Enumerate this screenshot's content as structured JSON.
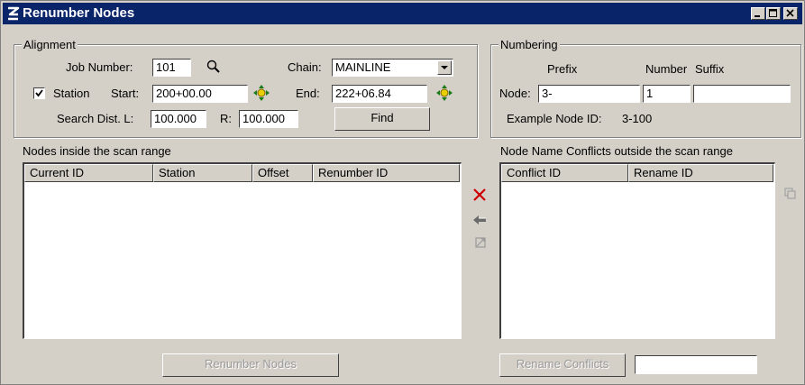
{
  "window": {
    "title": "Renumber Nodes"
  },
  "alignment": {
    "group_label": "Alignment",
    "job_number_label": "Job Number:",
    "job_number_value": "101",
    "chain_label": "Chain:",
    "chain_value": "MAINLINE",
    "station_checkbox_label": "Station",
    "station_checked": true,
    "start_label": "Start:",
    "start_value": "200+00.00",
    "end_label": "End:",
    "end_value": "222+06.84",
    "search_dist_label": "Search Dist. L:",
    "search_left_value": "100.000",
    "right_label": "R:",
    "search_right_value": "100.000",
    "find_label": "Find"
  },
  "numbering": {
    "group_label": "Numbering",
    "prefix_header": "Prefix",
    "number_header": "Number",
    "suffix_header": "Suffix",
    "node_label": "Node:",
    "prefix_value": "3-",
    "number_value": "1",
    "suffix_value": "",
    "example_label": "Example Node ID:",
    "example_value": "3-100"
  },
  "nodes_list": {
    "title": "Nodes inside the scan range",
    "columns": [
      "Current ID",
      "Station",
      "Offset",
      "Renumber ID"
    ],
    "rows": []
  },
  "conflicts_list": {
    "title": "Node Name Conflicts outside the scan range",
    "columns": [
      "Conflict ID",
      "Rename ID"
    ],
    "rows": []
  },
  "buttons": {
    "renumber_nodes": "Renumber Nodes",
    "rename_conflicts": "Rename Conflicts",
    "rename_conflicts_value": ""
  },
  "colors": {
    "title_bar": "#0a246a",
    "face": "#d4d0c8",
    "delete_icon": "#cc0000"
  },
  "icons": [
    "app-logo-icon",
    "minimize-icon",
    "maximize-icon",
    "close-icon",
    "search-icon",
    "locate-start-icon",
    "locate-end-icon",
    "delete-icon",
    "move-icon",
    "swap-icon",
    "copy-icon",
    "dropdown-arrow-icon"
  ]
}
